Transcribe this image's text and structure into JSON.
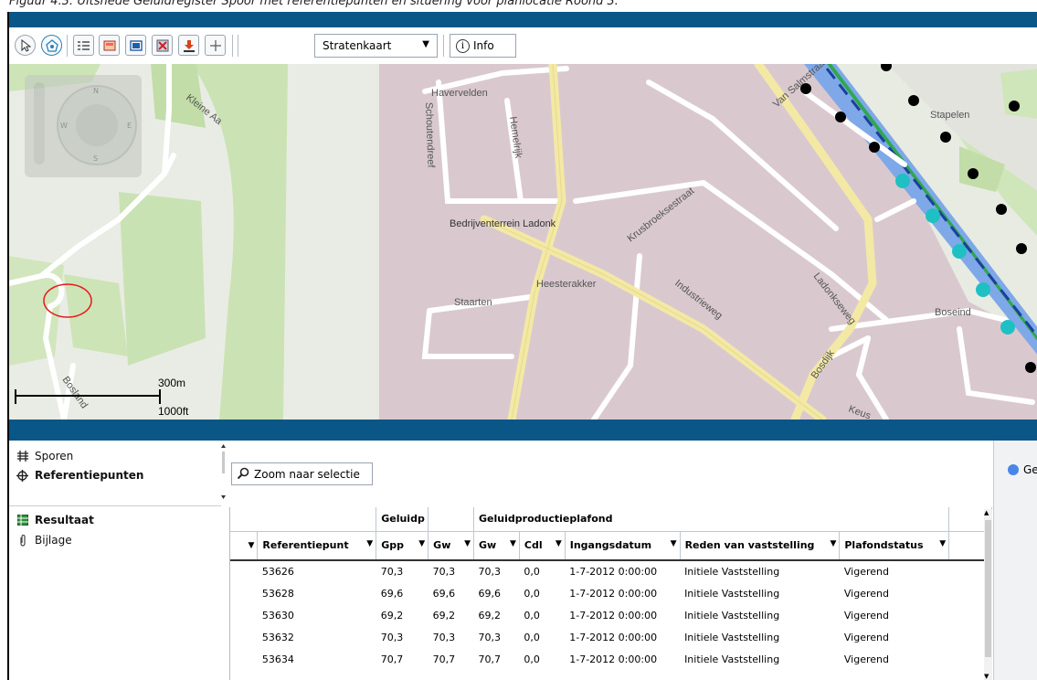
{
  "caption": "Figuur 4.3: Uitsnede Geluidregister Spoor met referentiepunten en situering voor planlocatie Roond 3.",
  "toolbar": {
    "map_type": "Stratenkaart",
    "info_label": "Info",
    "icons": [
      "cursor-icon",
      "identify-icon",
      "list-icon",
      "map-layers-icon",
      "window-icon",
      "clear-selection-icon",
      "download-icon",
      "measure-icon"
    ]
  },
  "map": {
    "labels": {
      "havervelden": "Havervelden",
      "schoutendreef": "Schoutendreef",
      "kleine_aa": "Kleine Aa",
      "hemelrijk": "Hemelrijk",
      "van_salmstraat": "Van Salmstraat",
      "stapelen": "Stapelen",
      "krusbroeksestraat": "Krusbroeksestraat",
      "bedrijventerrein": "Bedrijventerrein Ladonk",
      "heesterakker": "Heesterakker",
      "staarten": "Staarten",
      "industrieweg": "Industrieweg",
      "ladonkseweg": "Ladonkseweg",
      "bosdijk": "Bosdijk",
      "boseind": "Boseind",
      "keus": "Keus",
      "bosland": "Bosland"
    },
    "scale": {
      "metric": "300m",
      "imperial": "1000ft"
    }
  },
  "left_panel": {
    "sporen": "Sporen",
    "referentiepunten": "Referentiepunten",
    "resultaat": "Resultaat",
    "bijlage": "Bijlage"
  },
  "zoom_button": "Zoom naar selectie",
  "legend_label": "Ge",
  "table": {
    "group_headers": {
      "geluidp": "Geluidp",
      "geluidproductieplafond": "Geluidproductieplafond"
    },
    "columns": [
      "Referentiepunt",
      "Gpp",
      "Gw",
      "Gw",
      "Cdl",
      "Ingangsdatum",
      "Reden van vaststelling",
      "Plafondstatus"
    ],
    "rows": [
      [
        "53626",
        "70,3",
        "70,3",
        "70,3",
        "0,0",
        "1-7-2012 0:00:00",
        "Initiele Vaststelling",
        "Vigerend"
      ],
      [
        "53628",
        "69,6",
        "69,6",
        "69,6",
        "0,0",
        "1-7-2012 0:00:00",
        "Initiele Vaststelling",
        "Vigerend"
      ],
      [
        "53630",
        "69,2",
        "69,2",
        "69,2",
        "0,0",
        "1-7-2012 0:00:00",
        "Initiele Vaststelling",
        "Vigerend"
      ],
      [
        "53632",
        "70,3",
        "70,3",
        "70,3",
        "0,0",
        "1-7-2012 0:00:00",
        "Initiele Vaststelling",
        "Vigerend"
      ],
      [
        "53634",
        "70,7",
        "70,7",
        "70,7",
        "0,0",
        "1-7-2012 0:00:00",
        "Initiele Vaststelling",
        "Vigerend"
      ]
    ]
  }
}
